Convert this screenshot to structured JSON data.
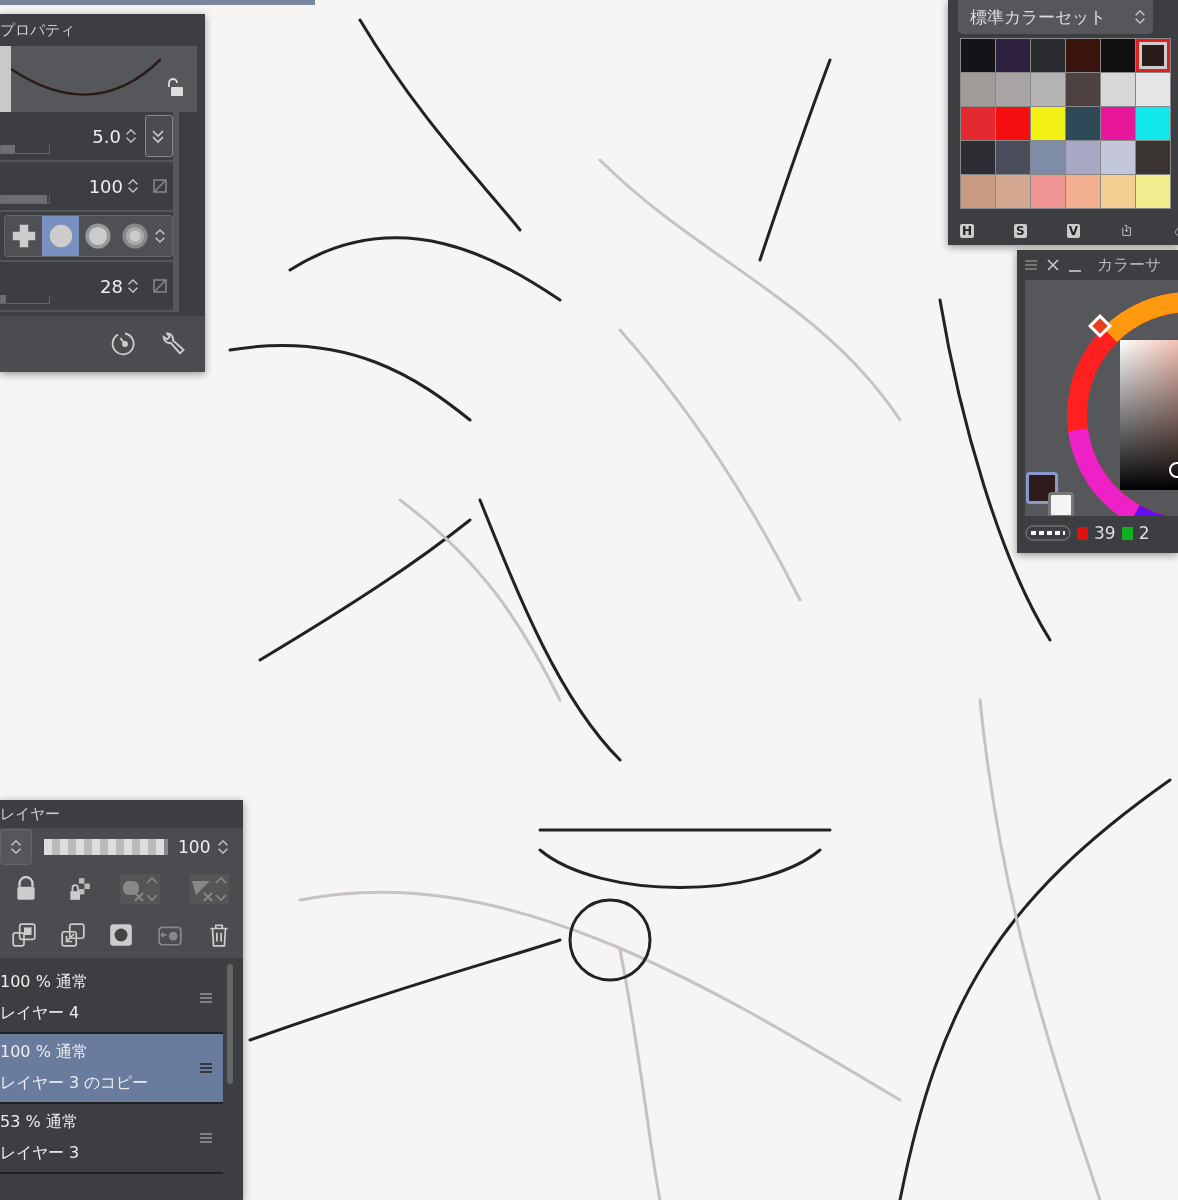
{
  "tool_property": {
    "title": "プロパティ",
    "params": [
      {
        "kind": "slider",
        "value": "5.0",
        "level": 0.3,
        "sync": true
      },
      {
        "kind": "slider",
        "value": "100",
        "level": 0.95,
        "sync": false
      },
      {
        "kind": "tips",
        "tips": [
          {
            "kind": "cross",
            "selected": false
          },
          {
            "kind": "circle",
            "selected": true
          },
          {
            "kind": "soft",
            "selected": false
          },
          {
            "kind": "softer",
            "selected": false
          }
        ]
      },
      {
        "kind": "slider",
        "value": "28",
        "level": 0.1,
        "sync": false
      }
    ]
  },
  "color_set": {
    "title": "標準カラーセット",
    "swatches": [
      {
        "color": "#141418",
        "selected": false
      },
      {
        "color": "#2e2240",
        "selected": false
      },
      {
        "color": "#2a2b2f",
        "selected": false
      },
      {
        "color": "#3a140e",
        "selected": false
      },
      {
        "color": "#101013",
        "selected": false
      },
      {
        "color": "#2a1a1a",
        "selected": true
      },
      {
        "color": "#a09a98",
        "selected": false
      },
      {
        "color": "#a8a4a3",
        "selected": false
      },
      {
        "color": "#b4b2b2",
        "selected": false
      },
      {
        "color": "#4e4240",
        "selected": false
      },
      {
        "color": "#d8d6d6",
        "selected": false
      },
      {
        "color": "#e6e5e5",
        "selected": false
      },
      {
        "color": "#e42a30",
        "selected": false
      },
      {
        "color": "#f41010",
        "selected": false
      },
      {
        "color": "#f2f014",
        "selected": false
      },
      {
        "color": "#2e4a58",
        "selected": false
      },
      {
        "color": "#e8169a",
        "selected": false
      },
      {
        "color": "#12e8ec",
        "selected": false
      },
      {
        "color": "#2c2e34",
        "selected": false
      },
      {
        "color": "#4a4e5c",
        "selected": false
      },
      {
        "color": "#7e8ca8",
        "selected": false
      },
      {
        "color": "#a8a8c4",
        "selected": false
      },
      {
        "color": "#c4c6dc",
        "selected": false
      },
      {
        "color": "#3a3432",
        "selected": false
      },
      {
        "color": "#c89a80",
        "selected": false
      },
      {
        "color": "#d4a890",
        "selected": false
      },
      {
        "color": "#f09494",
        "selected": false
      },
      {
        "color": "#f2b090",
        "selected": false
      },
      {
        "color": "#f2ce90",
        "selected": false
      },
      {
        "color": "#f2ee90",
        "selected": false
      }
    ],
    "modes": [
      "H",
      "S",
      "V"
    ]
  },
  "color_circle": {
    "title": "カラーサ",
    "main_chip": {
      "color": "#2e1c1c"
    },
    "sub_chip": {
      "color": "#f4f4f4"
    },
    "readings": [
      {
        "color": "#e01010",
        "value": "39"
      },
      {
        "color": "#10b020",
        "value": "2"
      }
    ]
  },
  "layers": {
    "title": "レイヤー",
    "opacity": "100",
    "opacity_slider": {
      "level": 1.0
    },
    "items": [
      {
        "blend": "100 % 通常",
        "name": "レイヤー 4",
        "selected": false
      },
      {
        "blend": "100 % 通常",
        "name": "レイヤー 3 のコピー",
        "selected": true
      },
      {
        "blend": "53 % 通常",
        "name": "レイヤー 3",
        "selected": false
      }
    ]
  }
}
